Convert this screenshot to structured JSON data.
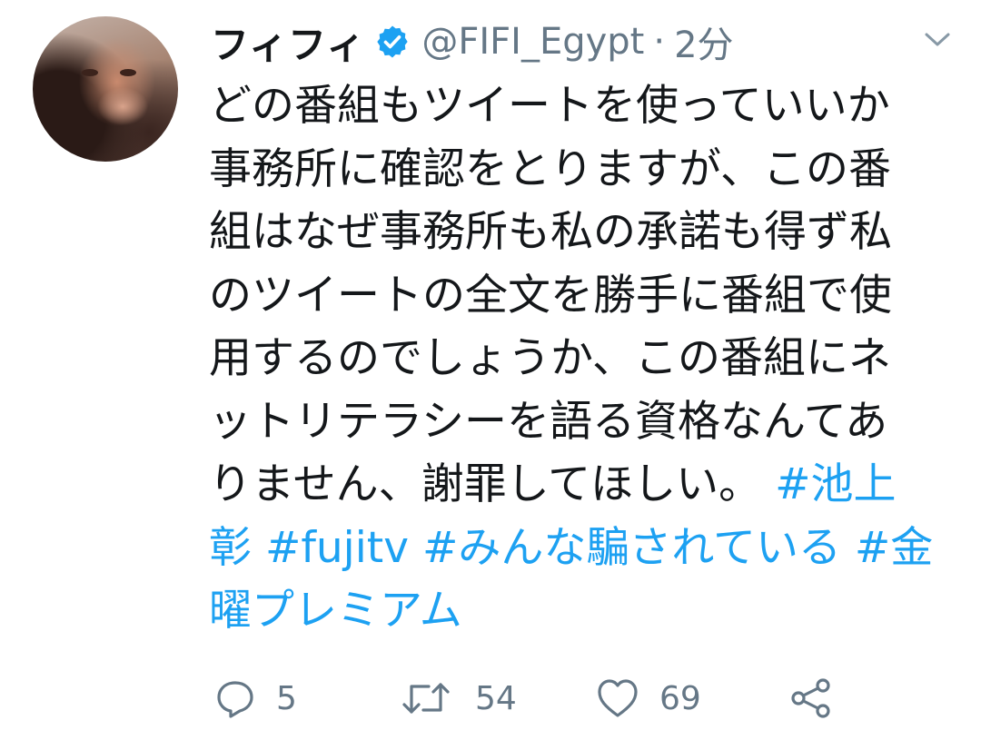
{
  "user": {
    "display_name": "フィフィ",
    "handle": "@FIFI_Egypt",
    "separator": "·",
    "time": "2分"
  },
  "tweet": {
    "lines": [
      [
        {
          "t": "どの番組もツイートを使っていいか"
        }
      ],
      [
        {
          "t": "事務所に確認をとりますが、この番"
        }
      ],
      [
        {
          "t": "組はなぜ事務所も私の承諾も得ず私"
        }
      ],
      [
        {
          "t": "のツイートの全文を勝手に番組で使"
        }
      ],
      [
        {
          "t": "用するのでしょうか、この番組にネ"
        }
      ],
      [
        {
          "t": "ットリテラシーを語る資格なんてあ"
        }
      ],
      [
        {
          "t": "りません、謝罪してほしい。 "
        },
        {
          "t": "#池上",
          "tag": true
        }
      ],
      [
        {
          "t": "彰",
          "tag": true
        },
        {
          "t": " "
        },
        {
          "t": "#fujitv",
          "tag": true
        },
        {
          "t": " "
        },
        {
          "t": "#みんな騙されている",
          "tag": true
        },
        {
          "t": " "
        },
        {
          "t": "#金",
          "tag": true
        }
      ],
      [
        {
          "t": "曜プレミアム",
          "tag": true
        }
      ]
    ]
  },
  "actions": {
    "reply_count": "5",
    "retweet_count": "54",
    "like_count": "69"
  },
  "colors": {
    "text": "#14171a",
    "secondary": "#657786",
    "link": "#1da1f2",
    "verified": "#1da1f2"
  },
  "icons": {
    "verified": "verified-badge-icon",
    "menu": "chevron-down-icon",
    "reply": "reply-icon",
    "retweet": "retweet-icon",
    "like": "heart-icon",
    "share": "share-icon"
  }
}
